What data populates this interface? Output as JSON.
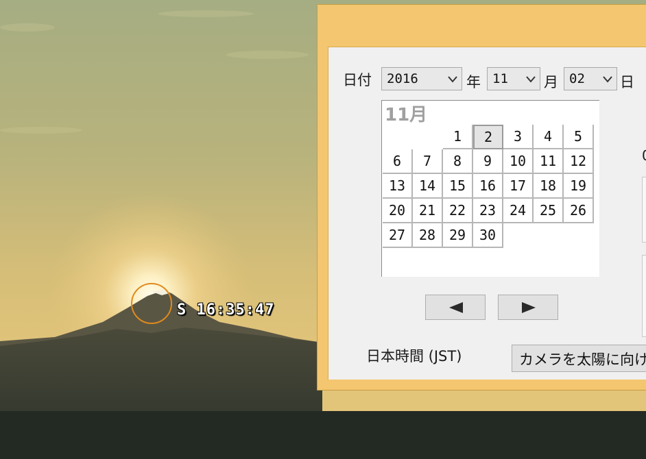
{
  "overlay": {
    "sun_label": "S 16:35:47"
  },
  "date_row": {
    "label": "日付",
    "year": {
      "value": "2016",
      "suffix": "年"
    },
    "month": {
      "value": "11",
      "suffix": "月"
    },
    "day": {
      "value": "02",
      "suffix": "日"
    }
  },
  "calendar": {
    "month_title": "11月",
    "selected_day": 2,
    "weeks": [
      [
        "",
        "",
        "1",
        "2",
        "3",
        "4",
        "5"
      ],
      [
        "6",
        "7",
        "8",
        "9",
        "10",
        "11",
        "12"
      ],
      [
        "13",
        "14",
        "15",
        "16",
        "17",
        "18",
        "19"
      ],
      [
        "20",
        "21",
        "22",
        "23",
        "24",
        "25",
        "26"
      ],
      [
        "27",
        "28",
        "29",
        "30",
        "",
        "",
        ""
      ]
    ]
  },
  "nav": {
    "prev_icon": "triangle-left-icon",
    "next_icon": "triangle-right-icon"
  },
  "timezone_label": "日本時間 (JST)",
  "camera_button_label": "カメラを太陽に向け",
  "right_edge_fragment": "0",
  "colors": {
    "window_frame": "#f3c66f",
    "client_bg": "#f0f0f0",
    "sun_marker": "#e08a1e"
  }
}
